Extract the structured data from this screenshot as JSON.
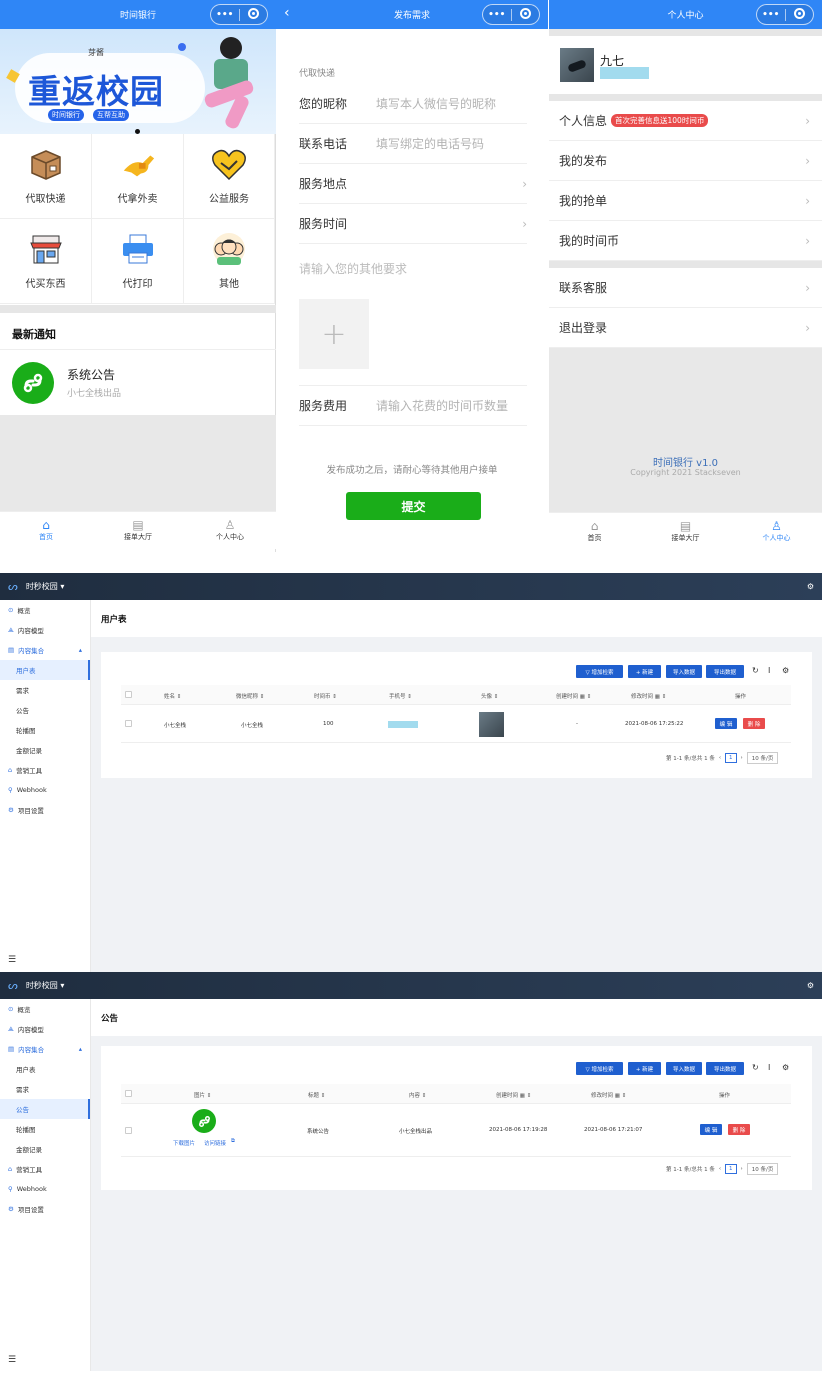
{
  "home": {
    "title": "时间银行",
    "capsule_dots": "•••",
    "banner": {
      "brand": "芽酱",
      "headline": "重返校园",
      "tags": [
        "时间银行",
        "互帮互助"
      ]
    },
    "services": [
      {
        "label": "代取快递",
        "icon": "package-icon"
      },
      {
        "label": "代拿外卖",
        "icon": "delivery-kangaroo-icon"
      },
      {
        "label": "公益服务",
        "icon": "handshake-heart-icon"
      },
      {
        "label": "代买东西",
        "icon": "store-icon"
      },
      {
        "label": "代打印",
        "icon": "printer-icon"
      },
      {
        "label": "其他",
        "icon": "people-icon"
      }
    ],
    "notice_header": "最新通知",
    "notice": {
      "title": "系统公告",
      "subtitle": "小七全栈出品"
    },
    "tabs": [
      {
        "label": "首页"
      },
      {
        "label": "接单大厅"
      },
      {
        "label": "个人中心"
      }
    ]
  },
  "publish": {
    "title": "发布需求",
    "category": "代取快递",
    "nickname": {
      "label": "您的昵称",
      "placeholder": "填写本人微信号的昵称"
    },
    "phone": {
      "label": "联系电话",
      "placeholder": "填写绑定的电话号码"
    },
    "location": {
      "label": "服务地点"
    },
    "time": {
      "label": "服务时间"
    },
    "other_placeholder": "请输入您的其他要求",
    "fee": {
      "label": "服务费用",
      "placeholder": "请输入花费的时间币数量"
    },
    "hint": "发布成功之后，请耐心等待其他用户接单",
    "submit": "提交"
  },
  "profile": {
    "title": "个人中心",
    "username": "九七",
    "menu1": [
      {
        "label": "个人信息",
        "badge": "首次完善信息送100时间币"
      },
      {
        "label": "我的发布"
      },
      {
        "label": "我的抢单"
      },
      {
        "label": "我的时间币"
      }
    ],
    "menu2": [
      {
        "label": "联系客服"
      },
      {
        "label": "退出登录"
      }
    ],
    "version": "时间银行 v1.0",
    "copyright": "Copyright 2021 Stackseven",
    "tabs": [
      {
        "label": "首页"
      },
      {
        "label": "接单大厅"
      },
      {
        "label": "个人中心"
      }
    ]
  },
  "admin": {
    "brand": "时秒校园 ▾",
    "sidebar": [
      {
        "label": "概览",
        "icon": "dashboard-icon"
      },
      {
        "label": "内容模型",
        "icon": "model-icon"
      },
      {
        "label": "内容集合",
        "icon": "collection-icon"
      },
      {
        "label": "用户表"
      },
      {
        "label": "需求"
      },
      {
        "label": "公告"
      },
      {
        "label": "轮播图"
      },
      {
        "label": "金额记录"
      },
      {
        "label": "营销工具",
        "icon": "marketing-icon"
      },
      {
        "label": "Webhook",
        "icon": "webhook-icon"
      },
      {
        "label": "项目设置",
        "icon": "settings-icon"
      }
    ],
    "buttons": {
      "filter": "▽ 增加检索",
      "new": "+ 新建",
      "import": "导入数据",
      "export": "导出数据"
    },
    "pagination": {
      "summary": "第 1-1 条/总共 1 条",
      "page": "1",
      "page_size": "10 条/页"
    },
    "users": {
      "title": "用户表",
      "columns": [
        "姓名 ⇕",
        "微信昵称 ⇕",
        "时间币 ⇕",
        "手机号 ⇕",
        "头像 ⇕",
        "创建时间 ▦ ⇕",
        "修改时间 ▦ ⇕",
        "操作"
      ],
      "row": {
        "name": "小七全栈",
        "nickname": "小七全栈",
        "coins": "100",
        "created": "-",
        "modified": "2021-08-06 17:25:22",
        "edit": "编 辑",
        "delete": "删 除"
      }
    },
    "notices": {
      "title": "公告",
      "columns": [
        "图片 ⇕",
        "标题 ⇕",
        "内容 ⇕",
        "创建时间 ▦ ⇕",
        "修改时间 ▦ ⇕",
        "操作"
      ],
      "row": {
        "download": "下载图片",
        "link": "访问链接",
        "title": "系统公告",
        "content": "小七全栈出品",
        "created": "2021-08-06 17:19:28",
        "modified": "2021-08-06 17:21:07",
        "edit": "编 辑",
        "delete": "删 除"
      }
    }
  },
  "colors": {
    "primary": "#2f86f6",
    "green": "#1aad19",
    "admin_blue": "#1f5fcf",
    "danger": "#e94b4b"
  }
}
